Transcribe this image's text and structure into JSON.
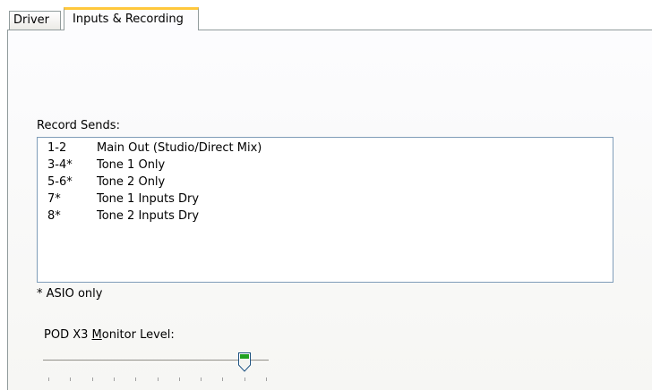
{
  "tabs": [
    {
      "label": "Driver",
      "selected": false
    },
    {
      "label": "Inputs & Recording",
      "selected": true
    }
  ],
  "record_sends": {
    "label": "Record Sends:",
    "items": [
      {
        "channel": "1-2",
        "description": "Main Out (Studio/Direct Mix)"
      },
      {
        "channel": "3-4*",
        "description": "Tone 1 Only"
      },
      {
        "channel": "5-6*",
        "description": "Tone 2 Only"
      },
      {
        "channel": "7*",
        "description": "Tone 1 Inputs Dry"
      },
      {
        "channel": "8*",
        "description": "Tone 2 Inputs Dry"
      }
    ]
  },
  "note": "* ASIO only",
  "monitor_level": {
    "label_before": "POD X3 ",
    "label_mnemonic": "M",
    "label_after": "onitor Level:",
    "value_fraction": 0.9,
    "tick_count": 11
  },
  "colors": {
    "tab_highlight": "#ffc83c",
    "thumb_fill": "#21a121",
    "border": "#919b9c",
    "listbox_border": "#7f9db9"
  }
}
